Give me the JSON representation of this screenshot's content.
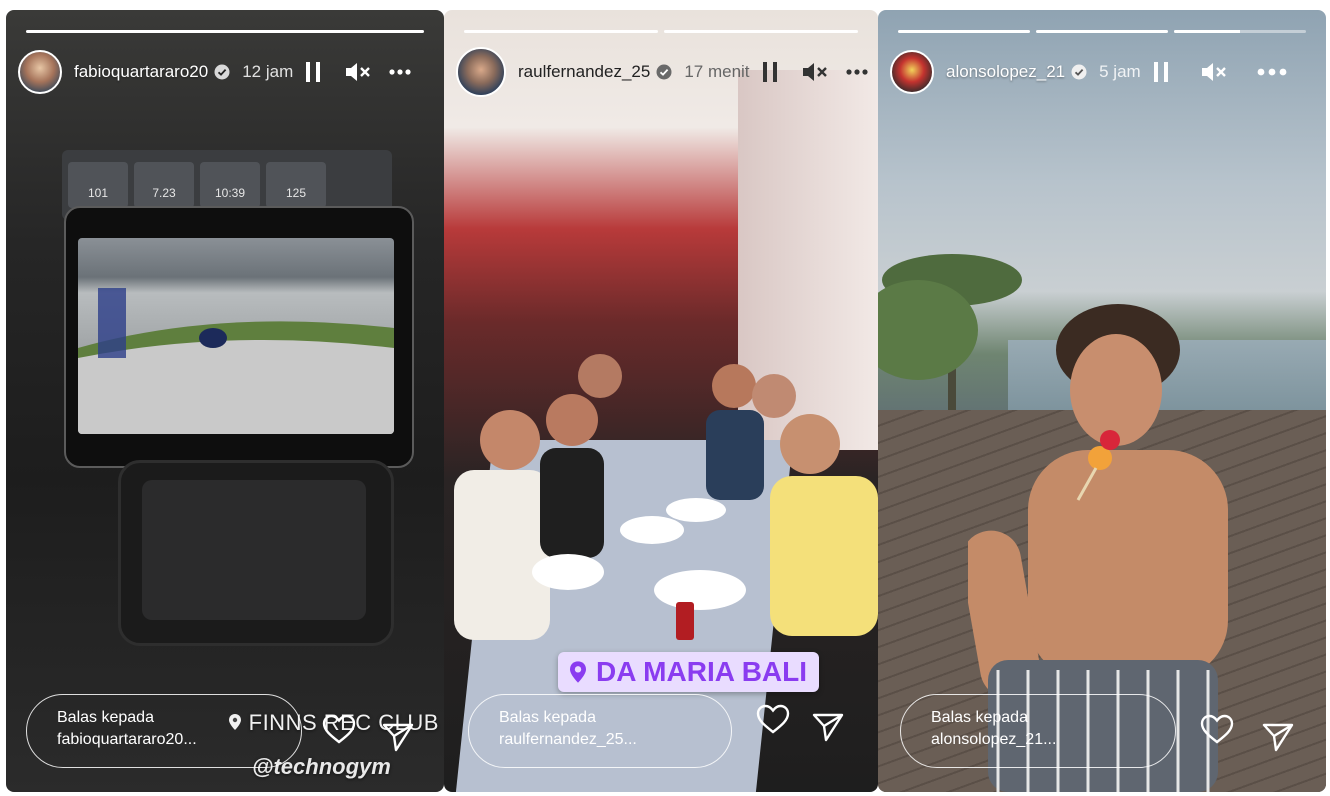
{
  "stories": [
    {
      "username": "fabioquartararo20",
      "time": "12 jam",
      "reply_line1": "Balas kepada",
      "reply_line2": "fabioquartararo20...",
      "location_tag": "FINNS REC CLUB",
      "brand_tag": "@technogym",
      "progress": [
        1,
        0.0
      ],
      "gym_stats": [
        "101",
        "7.23",
        "10:39",
        "125"
      ]
    },
    {
      "username": "raulfernandez_25",
      "time": "17 menit",
      "reply_line1": "Balas kepada",
      "reply_line2": "raulfernandez_25...",
      "location_sticker": "DA MARIA BALI",
      "progress": [
        1,
        1
      ]
    },
    {
      "username": "alonsolopez_21",
      "time": "5 jam",
      "reply_line1": "Balas kepada",
      "reply_line2": "alonsolopez_21...",
      "progress": [
        1,
        1,
        0.5
      ]
    }
  ],
  "colors": {
    "verified_badge": "#3897f0",
    "sticker_bg": "#e9dcff",
    "sticker_text": "#8a3cf0"
  },
  "icons": [
    "verified-badge-icon",
    "pause-icon",
    "mute-icon",
    "more-icon",
    "heart-icon",
    "send-icon",
    "location-pin-icon"
  ]
}
